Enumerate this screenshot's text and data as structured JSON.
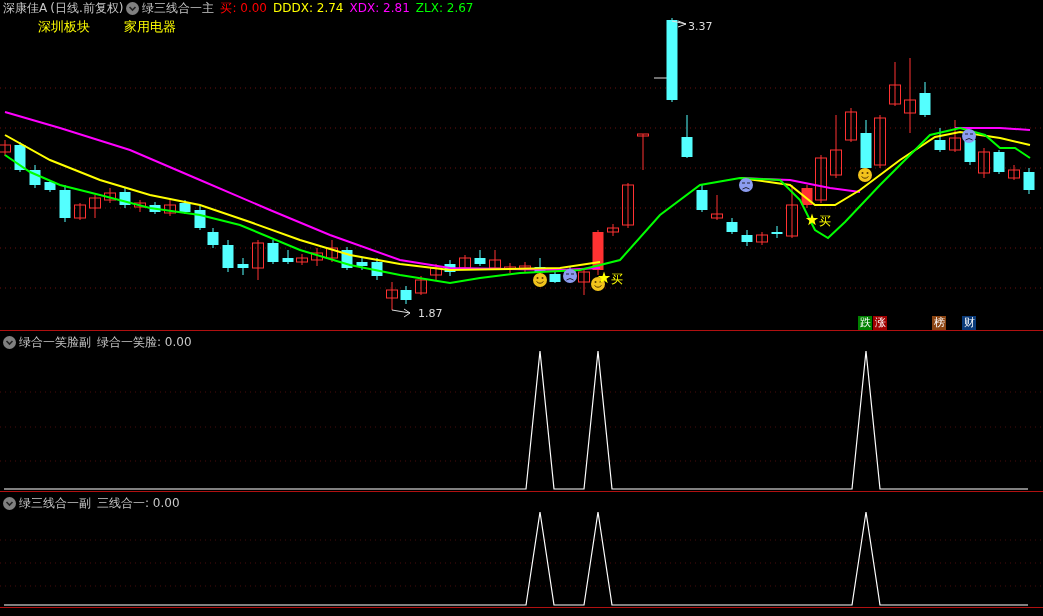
{
  "header": {
    "stock": "深康佳A",
    "period": "(日线.前复权)",
    "indicator": "绿三线合一主",
    "readouts": [
      {
        "text": "买: 0.00",
        "color": "#ff0000"
      },
      {
        "text": "DDDX: 2.74",
        "color": "#ffff00"
      },
      {
        "text": "XDX: 2.81",
        "color": "#ff00ff"
      },
      {
        "text": "ZLX: 2.67",
        "color": "#00ff00"
      }
    ],
    "sectors": [
      "深圳板块",
      "家用电器"
    ]
  },
  "main_chart": {
    "high_label": "3.37",
    "low_label": "1.87",
    "signals": [
      "买",
      "买"
    ],
    "badges": [
      {
        "text": "跌",
        "color": "#008000"
      },
      {
        "text": "涨",
        "color": "#a00000"
      },
      {
        "text": "榜",
        "color": "#8b4513"
      },
      {
        "text": "财",
        "color": "#0a3a78"
      }
    ]
  },
  "sub_panels": [
    {
      "indicator": "绿合一笑脸副",
      "readout": "绿合一笑脸: 0.00"
    },
    {
      "indicator": "绿三线合一副",
      "readout": "三线合一: 0.00"
    }
  ]
}
